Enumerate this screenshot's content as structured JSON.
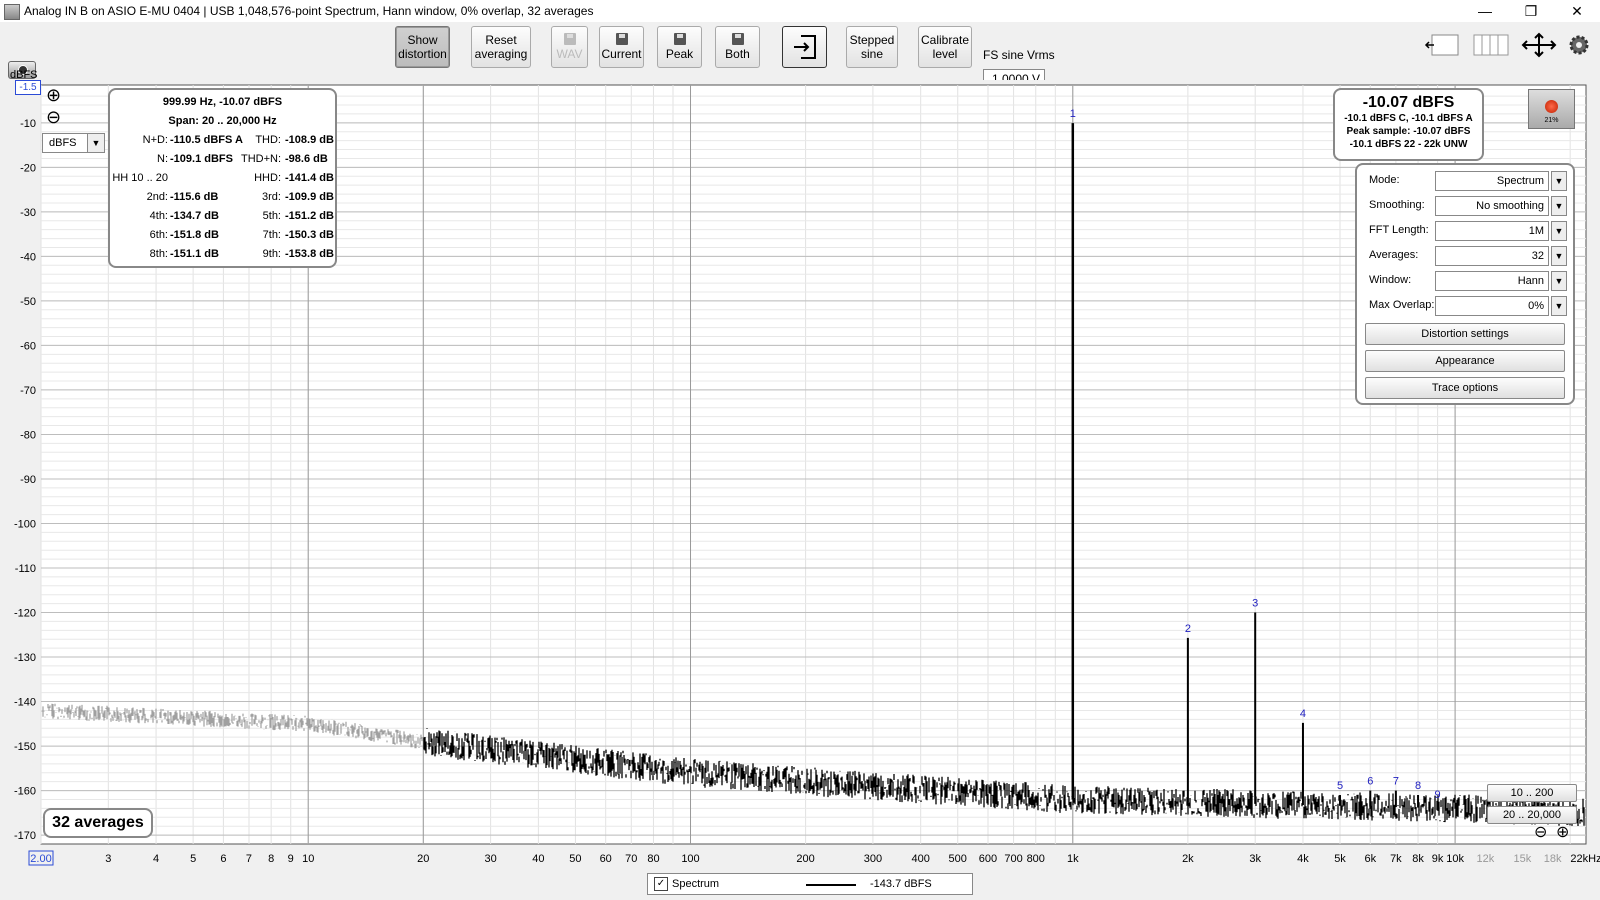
{
  "window": {
    "title": "Analog IN B on ASIO E-MU 0404 | USB 1,048,576-point Spectrum, Hann window, 0% overlap, 32 averages",
    "minimize": "—",
    "restore": "❐",
    "close": "✕"
  },
  "toolbar": {
    "show_distortion": [
      "Show",
      "distortion"
    ],
    "reset_averaging": [
      "Reset",
      "averaging"
    ],
    "wav": "WAV",
    "current": "Current",
    "peak": "Peak",
    "both": "Both",
    "stepped_sine": [
      "Stepped",
      "sine"
    ],
    "calibrate_level": [
      "Calibrate",
      "level"
    ],
    "fs_label": "FS sine Vrms",
    "fs_value": "1.0000 V"
  },
  "left": {
    "unit_label": "dBFS",
    "top_value": "-1.5",
    "unit_select": "dBFS",
    "zoom_in": "⊕",
    "zoom_out": "⊖",
    "averages_badge": "32 averages"
  },
  "stats": {
    "header": "999.99 Hz, -10.07 dBFS",
    "span": "Span: 20 .. 20,000 Hz",
    "rows": [
      {
        "l1": "N+D:",
        "v1": "-110.5 dBFS A",
        "l2": "THD:",
        "v2": "-108.9 dB"
      },
      {
        "l1": "N:",
        "v1": "-109.1 dBFS",
        "l2": "THD+N:",
        "v2": "-98.6 dB"
      },
      {
        "l1": "HH 10 .. 20",
        "v1": "",
        "l2": "HHD:",
        "v2": "-141.4 dB"
      },
      {
        "l1": "2nd:",
        "v1": "-115.6 dB",
        "l2": "3rd:",
        "v2": "-109.9 dB"
      },
      {
        "l1": "4th:",
        "v1": "-134.7 dB",
        "l2": "5th:",
        "v2": "-151.2 dB"
      },
      {
        "l1": "6th:",
        "v1": "-151.8 dB",
        "l2": "7th:",
        "v2": "-150.3 dB"
      },
      {
        "l1": "8th:",
        "v1": "-151.1 dB",
        "l2": "9th:",
        "v2": "-153.8 dB"
      }
    ]
  },
  "level": {
    "main": "-10.07 dBFS",
    "line1": "-10.1 dBFS C, -10.1 dBFS A",
    "line2": "Peak sample: -10.07 dBFS",
    "line3": "-10.1 dBFS 22 - 22k UNW",
    "rec_pct": "21%"
  },
  "settings": {
    "rows": [
      {
        "label": "Mode:",
        "value": "Spectrum"
      },
      {
        "label": "Smoothing:",
        "value": "No  smoothing"
      },
      {
        "label": "FFT Length:",
        "value": "1M"
      },
      {
        "label": "Averages:",
        "value": "32"
      },
      {
        "label": "Window:",
        "value": "Hann"
      },
      {
        "label": "Max Overlap:",
        "value": "0%"
      }
    ],
    "distortion_settings": "Distortion settings",
    "appearance": "Appearance",
    "trace_options": "Trace options"
  },
  "range_buttons": {
    "a": "10 .. 200",
    "b": "20 .. 20,000"
  },
  "legend": {
    "check": "✓",
    "name": "Spectrum",
    "value": "-143.7 dBFS"
  },
  "chart_data": {
    "type": "line",
    "ylabel": "dBFS",
    "ylim": [
      -172,
      -1.5
    ],
    "xlim": [
      2,
      22000
    ],
    "x_scale": "log",
    "y_ticks": [
      -10,
      -20,
      -30,
      -40,
      -50,
      -60,
      -70,
      -80,
      -90,
      -100,
      -110,
      -120,
      -130,
      -140,
      -150,
      -160,
      -170
    ],
    "x_ticks": [
      {
        "v": 2,
        "label": "2.00"
      },
      {
        "v": 3,
        "label": "3"
      },
      {
        "v": 4,
        "label": "4"
      },
      {
        "v": 5,
        "label": "5"
      },
      {
        "v": 6,
        "label": "6"
      },
      {
        "v": 7,
        "label": "7"
      },
      {
        "v": 8,
        "label": "8"
      },
      {
        "v": 9,
        "label": "9"
      },
      {
        "v": 10,
        "label": "10"
      },
      {
        "v": 20,
        "label": "20"
      },
      {
        "v": 30,
        "label": "30"
      },
      {
        "v": 40,
        "label": "40"
      },
      {
        "v": 50,
        "label": "50"
      },
      {
        "v": 60,
        "label": "60"
      },
      {
        "v": 70,
        "label": "70"
      },
      {
        "v": 80,
        "label": "80"
      },
      {
        "v": 100,
        "label": "100"
      },
      {
        "v": 200,
        "label": "200"
      },
      {
        "v": 300,
        "label": "300"
      },
      {
        "v": 400,
        "label": "400"
      },
      {
        "v": 500,
        "label": "500"
      },
      {
        "v": 600,
        "label": "600"
      },
      {
        "v": 700,
        "label": "700"
      },
      {
        "v": 800,
        "label": "800"
      },
      {
        "v": 1000,
        "label": "1k"
      },
      {
        "v": 2000,
        "label": "2k"
      },
      {
        "v": 3000,
        "label": "3k"
      },
      {
        "v": 4000,
        "label": "4k"
      },
      {
        "v": 5000,
        "label": "5k"
      },
      {
        "v": 6000,
        "label": "6k"
      },
      {
        "v": 7000,
        "label": "7k"
      },
      {
        "v": 8000,
        "label": "8k"
      },
      {
        "v": 9000,
        "label": "9k"
      },
      {
        "v": 10000,
        "label": "10k"
      },
      {
        "v": 12000,
        "label": "12k"
      },
      {
        "v": 15000,
        "label": "15k"
      },
      {
        "v": 18000,
        "label": "18k"
      },
      {
        "v": 22000,
        "label": "22kHz"
      }
    ],
    "series": [
      {
        "name": "Spectrum",
        "noise_floor": [
          {
            "x": 2,
            "y": -142
          },
          {
            "x": 10,
            "y": -145
          },
          {
            "x": 20,
            "y": -149
          },
          {
            "x": 50,
            "y": -153
          },
          {
            "x": 100,
            "y": -156
          },
          {
            "x": 300,
            "y": -159
          },
          {
            "x": 1000,
            "y": -162
          },
          {
            "x": 3000,
            "y": -163
          },
          {
            "x": 10000,
            "y": -164
          },
          {
            "x": 22000,
            "y": -165
          }
        ],
        "peaks": [
          {
            "label": "1",
            "x": 1000,
            "y": -10.07
          },
          {
            "label": "2",
            "x": 2000,
            "y": -125.7
          },
          {
            "label": "3",
            "x": 3000,
            "y": -120
          },
          {
            "label": "4",
            "x": 4000,
            "y": -144.8
          },
          {
            "label": "5",
            "x": 5000,
            "y": -161
          },
          {
            "label": "6",
            "x": 6000,
            "y": -160
          },
          {
            "label": "7",
            "x": 7000,
            "y": -160
          },
          {
            "label": "8",
            "x": 8000,
            "y": -161
          },
          {
            "label": "9",
            "x": 9000,
            "y": -163
          }
        ]
      }
    ]
  }
}
